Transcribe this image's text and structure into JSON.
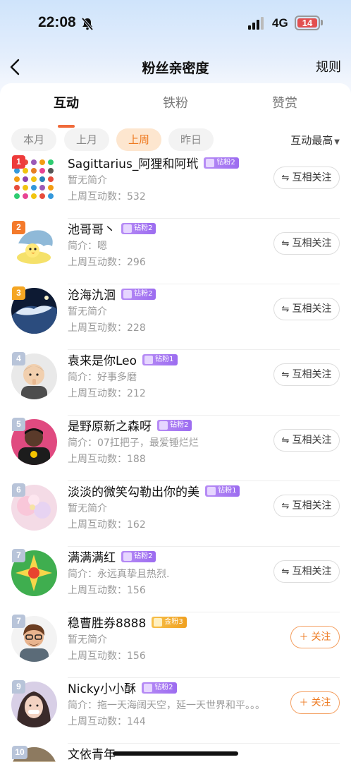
{
  "status_bar": {
    "time": "22:08",
    "network": "4G",
    "battery": "14",
    "icons": [
      "bell-slash-icon",
      "signal-icon"
    ]
  },
  "nav": {
    "back_icon": "chevron-left-icon",
    "title": "粉丝亲密度",
    "rules": "规则"
  },
  "tabs": [
    {
      "label": "互动",
      "active": true
    },
    {
      "label": "铁粉",
      "active": false
    },
    {
      "label": "赞赏",
      "active": false
    }
  ],
  "filters": [
    {
      "label": "本月",
      "active": false
    },
    {
      "label": "上月",
      "active": false
    },
    {
      "label": "上周",
      "active": true
    },
    {
      "label": "昨日",
      "active": false
    }
  ],
  "sort": {
    "label": "互动最高",
    "icon": "caret-down-icon"
  },
  "colors": {
    "accent": "#ee7a20",
    "rank_1": "#ee3b3b",
    "rank_2": "#f47a2b",
    "rank_3": "#f5a623",
    "badge_purple": "#a877f2",
    "badge_gold": "#f3b33a"
  },
  "fans": [
    {
      "rank": "1",
      "name": "Sagittarius_阿狸和阿玳",
      "badge": "钻粉2",
      "badge_type": "purple",
      "bio": "暂无简介",
      "count": "上周互动数：532",
      "action": "互相关注",
      "action_icon": "mutual-arrows-icon"
    },
    {
      "rank": "2",
      "name": "池哥哥丶",
      "badge": "钻粉2",
      "badge_type": "purple",
      "bio": "简介：嗯",
      "count": "上周互动数：296",
      "action": "互相关注",
      "action_icon": "mutual-arrows-icon"
    },
    {
      "rank": "3",
      "name": "沧海氿洄",
      "badge": "钻粉2",
      "badge_type": "purple",
      "bio": "暂无简介",
      "count": "上周互动数：228",
      "action": "互相关注",
      "action_icon": "mutual-arrows-icon"
    },
    {
      "rank": "4",
      "name": "袁来是你Leo",
      "badge": "钻粉1",
      "badge_type": "purple",
      "bio": "简介：好事多磨",
      "count": "上周互动数：212",
      "action": "互相关注",
      "action_icon": "mutual-arrows-icon"
    },
    {
      "rank": "5",
      "name": "是野原新之森呀",
      "badge": "钻粉2",
      "badge_type": "purple",
      "bio": "简介：07扛把子，最爱锤烂烂",
      "count": "上周互动数：188",
      "action": "互相关注",
      "action_icon": "mutual-arrows-icon"
    },
    {
      "rank": "6",
      "name": "淡淡的微笑勾勒出你的美",
      "badge": "钻粉1",
      "badge_type": "purple",
      "bio": "暂无简介",
      "count": "上周互动数：162",
      "action": "互相关注",
      "action_icon": "mutual-arrows-icon"
    },
    {
      "rank": "7",
      "name": "满满满红",
      "badge": "钻粉2",
      "badge_type": "purple",
      "bio": "简介：永远真挚且热烈.",
      "count": "上周互动数：156",
      "action": "互相关注",
      "action_icon": "mutual-arrows-icon"
    },
    {
      "rank": "7",
      "name": "稳曹胜券8888",
      "badge": "金粉3",
      "badge_type": "gold",
      "bio": "暂无简介",
      "count": "上周互动数：156",
      "action": "关注",
      "action_icon": "plus-icon"
    },
    {
      "rank": "9",
      "name": "Nicky小小酥",
      "badge": "钻粉2",
      "badge_type": "purple",
      "bio": "简介：拖一天海阔天空，延一天世界和平。。。",
      "count": "上周互动数：144",
      "action": "关注",
      "action_icon": "plus-icon"
    },
    {
      "rank": "10",
      "name": "文依青年",
      "badge": "",
      "badge_type": "gold",
      "bio": "",
      "count": "",
      "action": "",
      "action_icon": ""
    }
  ]
}
